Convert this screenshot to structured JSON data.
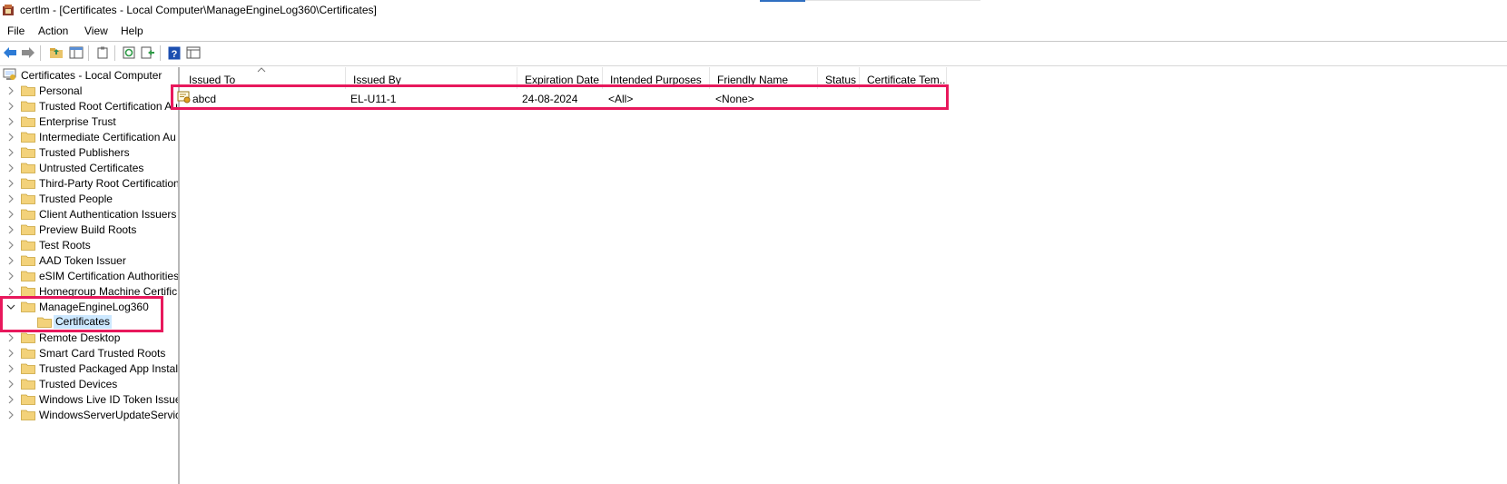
{
  "window": {
    "title": "certlm - [Certificates - Local Computer\\ManageEngineLog360\\Certificates]"
  },
  "menu": {
    "items": [
      "File",
      "Action",
      "View",
      "Help"
    ]
  },
  "toolbar": {
    "icons": [
      "back-icon",
      "forward-icon",
      "up-folder-icon",
      "show-hide-tree-icon",
      "copy-icon",
      "refresh-icon",
      "export-list-icon",
      "help-icon",
      "properties-icon"
    ]
  },
  "tree": {
    "root": "Certificates - Local Computer",
    "items": [
      "Personal",
      "Trusted Root Certification Au",
      "Enterprise Trust",
      "Intermediate Certification Au",
      "Trusted Publishers",
      "Untrusted Certificates",
      "Third-Party Root Certification",
      "Trusted People",
      "Client Authentication Issuers",
      "Preview Build Roots",
      "Test Roots",
      "AAD Token Issuer",
      "eSIM Certification Authorities",
      "Homegroup Machine Certific",
      "ManageEngineLog360",
      "Certificates",
      "Remote Desktop",
      "Smart Card Trusted Roots",
      "Trusted Packaged App Installa",
      "Trusted Devices",
      "Windows Live ID Token Issuer",
      "WindowsServerUpdateService"
    ]
  },
  "table": {
    "columns": [
      "Issued To",
      "Issued By",
      "Expiration Date",
      "Intended Purposes",
      "Friendly Name",
      "Status",
      "Certificate Tem..."
    ],
    "rows": [
      {
        "issued_to": "abcd",
        "issued_by": "EL-U11-1",
        "expiration": "24-08-2024",
        "purposes": "<All>",
        "friendly": "<None>",
        "status": "",
        "template": ""
      }
    ]
  },
  "colors": {
    "highlight": "#e8185c",
    "selected_bg": "#cce8ff",
    "folder": "#f3d27a"
  }
}
